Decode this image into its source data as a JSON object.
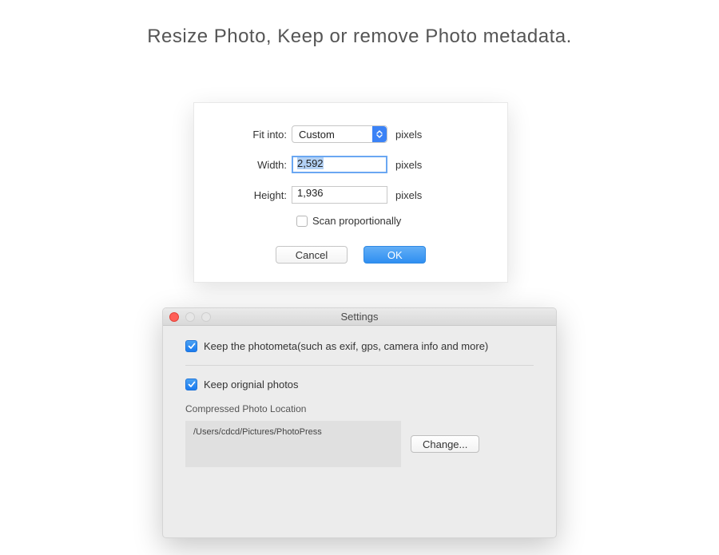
{
  "page_title": "Resize Photo, Keep or remove Photo metadata.",
  "resize": {
    "fit_into_label": "Fit into:",
    "fit_into_value": "Custom",
    "fit_into_unit": "pixels",
    "width_label": "Width:",
    "width_value": "2,592",
    "width_unit": "pixels",
    "height_label": "Height:",
    "height_value": "1,936",
    "height_unit": "pixels",
    "scan_prop_label": "Scan proportionally",
    "cancel_label": "Cancel",
    "ok_label": "OK"
  },
  "settings": {
    "window_title": "Settings",
    "keep_meta_label": "Keep the photometa(such as exif, gps, camera info and more)",
    "keep_original_label": "Keep orignial photos",
    "location_label": "Compressed Photo Location",
    "location_path": "/Users/cdcd/Pictures/PhotoPress",
    "change_label": "Change..."
  }
}
